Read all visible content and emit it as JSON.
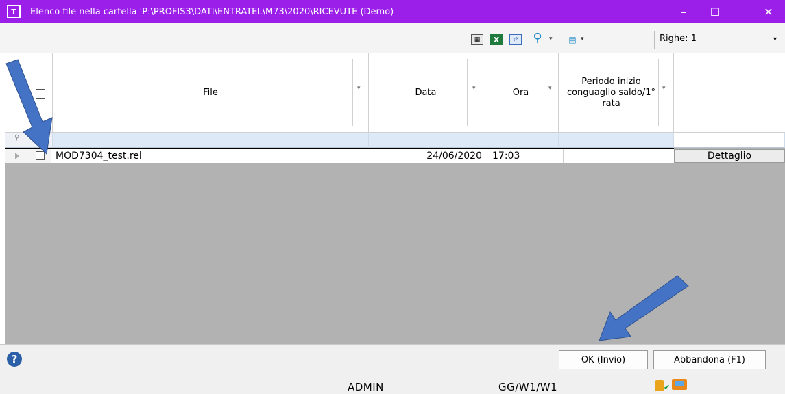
{
  "window": {
    "icon_text": "T",
    "title": "Elenco file nella cartella 'P:\\PROFIS3\\DATI\\ENTRATEL\\M73\\2020\\RICEVUTE  (Demo)",
    "minimize_glyph": "–",
    "maximize_glyph": "☐",
    "close_glyph": "✕"
  },
  "toolbar": {
    "print_icon": "print-preview-icon",
    "excel_icon_text": "X",
    "export_icon": "export-icon",
    "search_glyph": "⚲",
    "filter_glyph": "▤",
    "caret": "▾",
    "rows_label": "Righe: 1"
  },
  "grid": {
    "columns": [
      {
        "id": "file",
        "label": "File"
      },
      {
        "id": "data",
        "label": "Data"
      },
      {
        "id": "ora",
        "label": "Ora"
      },
      {
        "id": "periodo",
        "label": "Periodo inizio conguaglio saldo/1° rata"
      },
      {
        "id": "detail",
        "label": ""
      }
    ],
    "filter_glyph": "⚲",
    "rows": [
      {
        "file": "MOD7304_test.rel",
        "data": "24/06/2020",
        "ora": "17:03",
        "periodo": "",
        "detail_button": "Dettaglio"
      }
    ]
  },
  "footer": {
    "help_glyph": "?",
    "ok_button": "OK (Invio)",
    "cancel_button": "Abbandona (F1)",
    "user": "ADMIN",
    "workstation": "GG/W1/W1",
    "check_glyph": "✔"
  },
  "colors": {
    "titlebar": "#9b1fe8",
    "arrows": "#4472c4"
  }
}
